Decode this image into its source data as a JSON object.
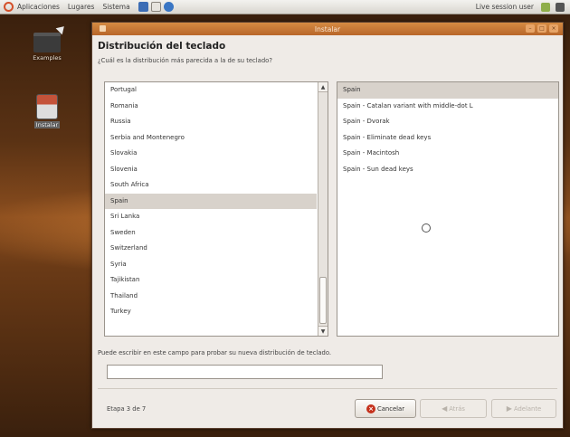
{
  "top_panel": {
    "menus": [
      "Aplicaciones",
      "Lugares",
      "Sistema"
    ],
    "user": "Live session user"
  },
  "desktop": {
    "icons": [
      {
        "label": "Examples"
      },
      {
        "label": "Instalar"
      }
    ]
  },
  "window": {
    "title": "Instalar",
    "heading": "Distribución del teclado",
    "question": "¿Cuál es la distribución más parecida a la de su teclado?",
    "left_list": {
      "items": [
        "Portugal",
        "Romania",
        "Russia",
        "Serbia and Montenegro",
        "Slovakia",
        "Slovenia",
        "South Africa",
        "Spain",
        "Sri Lanka",
        "Sweden",
        "Switzerland",
        "Syria",
        "Tajikistan",
        "Thailand",
        "Turkey"
      ],
      "selected": "Spain"
    },
    "right_list": {
      "items": [
        "Spain",
        "Spain - Catalan variant with middle-dot L",
        "Spain - Dvorak",
        "Spain - Eliminate dead keys",
        "Spain - Macintosh",
        "Spain - Sun dead keys"
      ],
      "selected": "Spain"
    },
    "test_hint": "Puede escribir en este campo para probar su nueva distribución de teclado.",
    "test_input_value": "",
    "step": "Etapa 3 de 7",
    "buttons": {
      "cancel": "Cancelar",
      "back": "Atrás",
      "forward": "Adelante"
    }
  },
  "colors": {
    "titlebar": "#c97a38",
    "selection": "#d8d2cb",
    "cancel_icon": "#c5311c"
  }
}
